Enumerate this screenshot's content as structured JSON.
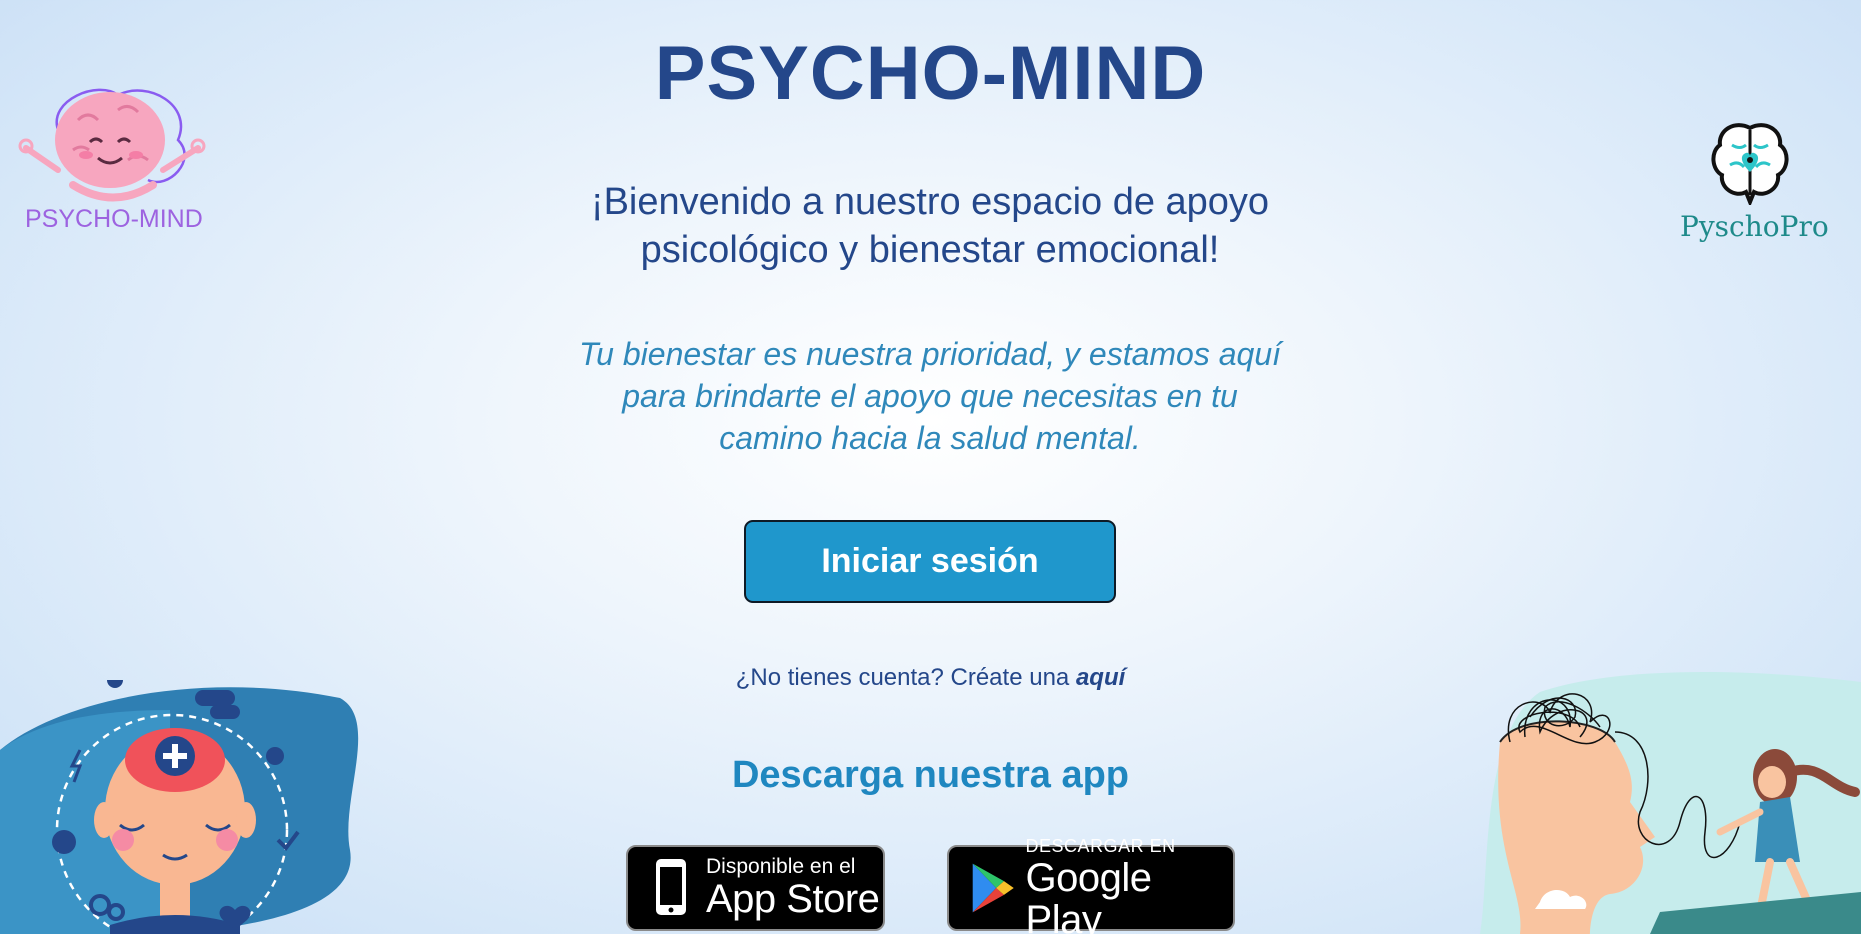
{
  "header": {
    "title": "PSYCHO-MIND",
    "logo_left_text": "PSYCHO-MIND",
    "logo_right_text": "PyschoPro"
  },
  "main": {
    "welcome_line1": "¡Bienvenido a nuestro espacio de apoyo",
    "welcome_line2": "psicológico y bienestar emocional!",
    "tagline_line1": "Tu bienestar es nuestra prioridad, y estamos aquí",
    "tagline_line2": "para brindarte el apoyo que necesitas en tu",
    "tagline_line3": "camino hacia la salud mental.",
    "login_label": "Iniciar sesión",
    "signup_prefix": "¿No tienes cuenta? Créate una ",
    "signup_link": "aquí"
  },
  "download": {
    "title": "Descarga nuestra app",
    "apple_small": "Disponible en el",
    "apple_big": "App Store",
    "google_small": "DESCARGAR EN",
    "google_big": "Google Play"
  },
  "colors": {
    "primary_dark": "#24478a",
    "accent_blue": "#1f97cc",
    "tagline": "#2f88ba",
    "logo_purple": "#9d63e0",
    "logo_teal": "#1e8a8a"
  },
  "icons": [
    "brain-mascot-logo",
    "brain-heart-logo",
    "apple-phone-icon",
    "google-play-icon",
    "mental-health-illustration",
    "tangled-mind-illustration"
  ]
}
